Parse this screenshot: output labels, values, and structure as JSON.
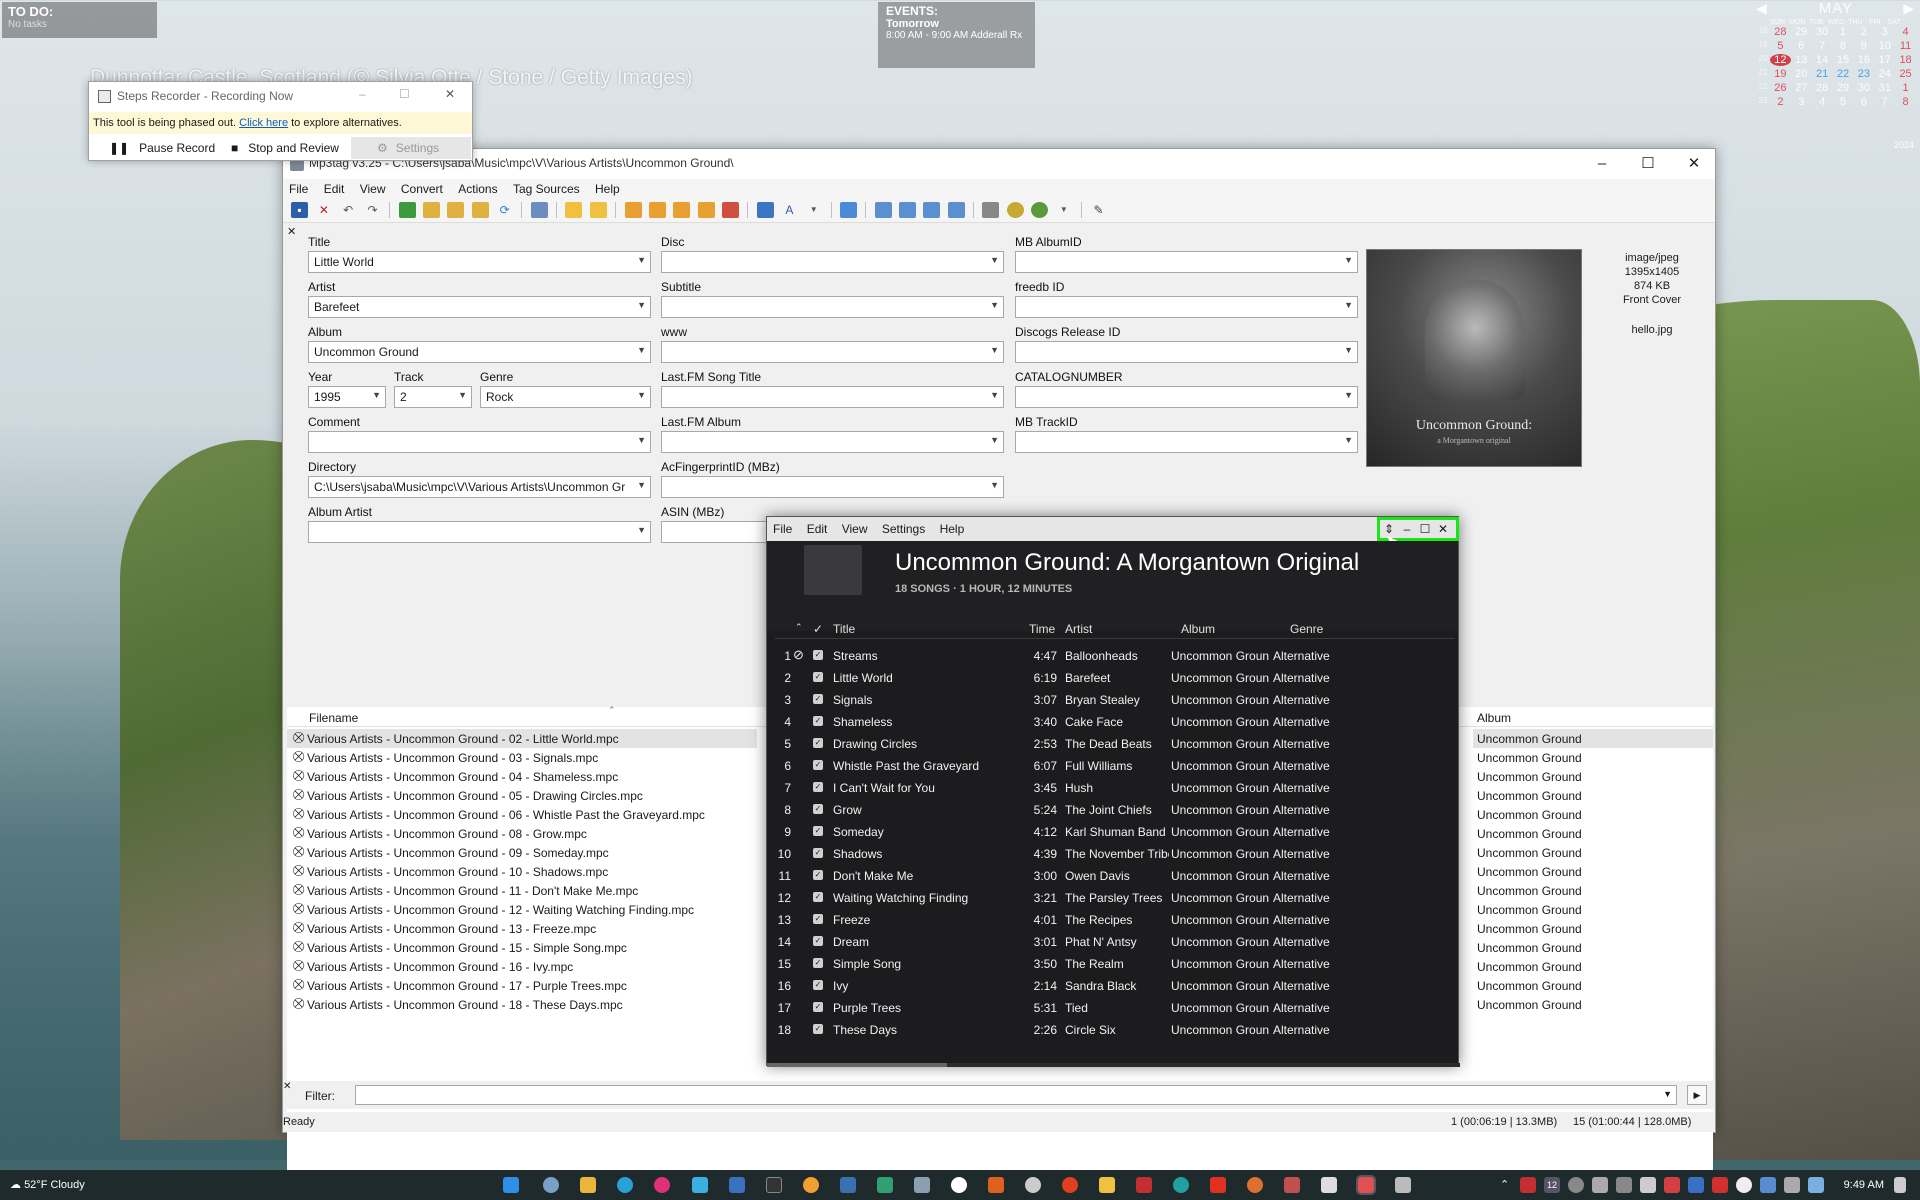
{
  "desktop": {
    "photo_credit": "Dunnottar Castle, Scotland (© Silvia Otte / Stone / Getty Images)",
    "todo": {
      "title": "TO DO:",
      "body": "No tasks"
    },
    "events": {
      "title": "EVENTS:",
      "day": "Tomorrow",
      "detail": "8:00 AM - 9:00 AM Adderall Rx"
    },
    "calendar": {
      "month": "MAY",
      "year": "2024",
      "dow": [
        "SUN",
        "MON",
        "TUE",
        "WED",
        "THU",
        "FRI",
        "SAT"
      ],
      "weeks": [
        {
          "wk": "18",
          "days": [
            "28",
            "29",
            "30",
            "1",
            "2",
            "3",
            "4"
          ]
        },
        {
          "wk": "19",
          "days": [
            "5",
            "6",
            "7",
            "8",
            "9",
            "10",
            "11"
          ]
        },
        {
          "wk": "20",
          "days": [
            "12",
            "13",
            "14",
            "15",
            "16",
            "17",
            "18"
          ]
        },
        {
          "wk": "21",
          "days": [
            "19",
            "20",
            "21",
            "22",
            "23",
            "24",
            "25"
          ]
        },
        {
          "wk": "22",
          "days": [
            "26",
            "27",
            "28",
            "29",
            "30",
            "31",
            "1"
          ]
        },
        {
          "wk": "23",
          "days": [
            "2",
            "3",
            "4",
            "5",
            "6",
            "7",
            "8"
          ]
        }
      ]
    }
  },
  "steps_recorder": {
    "title": "Steps Recorder - Recording Now",
    "warning_prefix": "This tool is being phased out.",
    "warning_link": "Click here",
    "warning_suffix": "to explore alternatives.",
    "pause_label": "Pause Record",
    "stop_label": "Stop and Review",
    "settings_label": "Settings"
  },
  "mp3tag": {
    "title": "Mp3tag v3.25 - C:\\Users\\jsaba\\Music\\mpc\\V\\Various Artists\\Uncommon Ground\\",
    "menu": [
      "File",
      "Edit",
      "View",
      "Convert",
      "Actions",
      "Tag Sources",
      "Help"
    ],
    "fields": {
      "title": {
        "label": "Title",
        "value": "Little World"
      },
      "artist": {
        "label": "Artist",
        "value": "Barefeet"
      },
      "album": {
        "label": "Album",
        "value": "Uncommon Ground"
      },
      "year": {
        "label": "Year",
        "value": "1995"
      },
      "track": {
        "label": "Track",
        "value": "2"
      },
      "genre": {
        "label": "Genre",
        "value": "Rock"
      },
      "comment": {
        "label": "Comment",
        "value": ""
      },
      "directory": {
        "label": "Directory",
        "value": "C:\\Users\\jsaba\\Music\\mpc\\V\\Various Artists\\Uncommon Gr"
      },
      "album_artist": {
        "label": "Album Artist",
        "value": ""
      },
      "disc": {
        "label": "Disc",
        "value": ""
      },
      "subtitle": {
        "label": "Subtitle",
        "value": ""
      },
      "www": {
        "label": "www",
        "value": ""
      },
      "lastfm_song_title": {
        "label": "Last.FM Song Title",
        "value": ""
      },
      "lastfm_album": {
        "label": "Last.FM Album",
        "value": ""
      },
      "acfingerprint": {
        "label": "AcFingerprintID (MBz)",
        "value": ""
      },
      "asin": {
        "label": "ASIN (MBz)",
        "value": ""
      },
      "mb_albumid": {
        "label": "MB AlbumID",
        "value": ""
      },
      "freedb_id": {
        "label": "freedb ID",
        "value": ""
      },
      "discogs_release_id": {
        "label": "Discogs Release ID",
        "value": ""
      },
      "catalognumber": {
        "label": "CATALOGNUMBER",
        "value": ""
      },
      "mb_trackid": {
        "label": "MB TrackID",
        "value": ""
      }
    },
    "cover": {
      "title": "Uncommon Ground:",
      "subtitle": "a Morgantown original",
      "mime": "image/jpeg",
      "dimensions": "1395x1405",
      "size": "874 KB",
      "type": "Front Cover",
      "filename": "hello.jpg"
    },
    "columns": {
      "filename": "Filename",
      "album": "Album"
    },
    "files": [
      {
        "name": "Various Artists  - Uncommon Ground  - 02  - Little World.mpc",
        "album": "Uncommon Ground"
      },
      {
        "name": "Various Artists  - Uncommon Ground  - 03  - Signals.mpc",
        "album": "Uncommon Ground"
      },
      {
        "name": "Various Artists  - Uncommon Ground  - 04  - Shameless.mpc",
        "album": "Uncommon Ground"
      },
      {
        "name": "Various Artists  - Uncommon Ground  - 05  - Drawing Circles.mpc",
        "album": "Uncommon Ground"
      },
      {
        "name": "Various Artists  - Uncommon Ground  - 06  - Whistle Past the Graveyard.mpc",
        "album": "Uncommon Ground"
      },
      {
        "name": "Various Artists  - Uncommon Ground  - 08  - Grow.mpc",
        "album": "Uncommon Ground"
      },
      {
        "name": "Various Artists  - Uncommon Ground  - 09  - Someday.mpc",
        "album": "Uncommon Ground"
      },
      {
        "name": "Various Artists  - Uncommon Ground  - 10  - Shadows.mpc",
        "album": "Uncommon Ground"
      },
      {
        "name": "Various Artists  - Uncommon Ground  - 11  - Don't Make Me.mpc",
        "album": "Uncommon Ground"
      },
      {
        "name": "Various Artists  - Uncommon Ground  - 12  - Waiting Watching Finding.mpc",
        "album": "Uncommon Ground"
      },
      {
        "name": "Various Artists  - Uncommon Ground  - 13  - Freeze.mpc",
        "album": "Uncommon Ground"
      },
      {
        "name": "Various Artists  - Uncommon Ground  - 15  - Simple Song.mpc",
        "album": "Uncommon Ground"
      },
      {
        "name": "Various Artists  - Uncommon Ground  - 16  - Ivy.mpc",
        "album": "Uncommon Ground"
      },
      {
        "name": "Various Artists  - Uncommon Ground  - 17  - Purple Trees.mpc",
        "album": "Uncommon Ground"
      },
      {
        "name": "Various Artists  - Uncommon Ground  - 18  - These Days.mpc",
        "album": "Uncommon Ground"
      }
    ],
    "filter_label": "Filter:",
    "status": {
      "ready": "Ready",
      "selection": "1 (00:06:19 | 13.3MB)",
      "total": "15 (01:00:44 | 128.0MB)"
    }
  },
  "player": {
    "menu": [
      "File",
      "Edit",
      "View",
      "Settings",
      "Help"
    ],
    "album_title": "Uncommon Ground: A Morgantown Original",
    "meta": "18 SONGS · 1 HOUR, 12 MINUTES",
    "columns": {
      "title": "Title",
      "time": "Time",
      "artist": "Artist",
      "album": "Album",
      "genre": "Genre"
    },
    "tracks": [
      {
        "n": "1",
        "title": "Streams",
        "time": "4:47",
        "artist": "Balloonheads",
        "album": "Uncommon Groun...",
        "genre": "Alternative"
      },
      {
        "n": "2",
        "title": "Little World",
        "time": "6:19",
        "artist": "Barefeet",
        "album": "Uncommon Groun...",
        "genre": "Alternative"
      },
      {
        "n": "3",
        "title": "Signals",
        "time": "3:07",
        "artist": "Bryan Stealey",
        "album": "Uncommon Groun...",
        "genre": "Alternative"
      },
      {
        "n": "4",
        "title": "Shameless",
        "time": "3:40",
        "artist": "Cake Face",
        "album": "Uncommon Groun...",
        "genre": "Alternative"
      },
      {
        "n": "5",
        "title": "Drawing Circles",
        "time": "2:53",
        "artist": "The Dead Beats",
        "album": "Uncommon Groun...",
        "genre": "Alternative"
      },
      {
        "n": "6",
        "title": "Whistle Past the Graveyard",
        "time": "6:07",
        "artist": "Full Williams",
        "album": "Uncommon Groun...",
        "genre": "Alternative"
      },
      {
        "n": "7",
        "title": "I Can't Wait for You",
        "time": "3:45",
        "artist": "Hush",
        "album": "Uncommon Groun...",
        "genre": "Alternative"
      },
      {
        "n": "8",
        "title": "Grow",
        "time": "5:24",
        "artist": "The Joint Chiefs",
        "album": "Uncommon Groun...",
        "genre": "Alternative"
      },
      {
        "n": "9",
        "title": "Someday",
        "time": "4:12",
        "artist": "Karl Shuman Band",
        "album": "Uncommon Groun...",
        "genre": "Alternative"
      },
      {
        "n": "10",
        "title": "Shadows",
        "time": "4:39",
        "artist": "The November Tribe",
        "album": "Uncommon Groun...",
        "genre": "Alternative"
      },
      {
        "n": "11",
        "title": "Don't Make Me",
        "time": "3:00",
        "artist": "Owen Davis",
        "album": "Uncommon Groun...",
        "genre": "Alternative"
      },
      {
        "n": "12",
        "title": "Waiting Watching Finding",
        "time": "3:21",
        "artist": "The Parsley Trees",
        "album": "Uncommon Groun...",
        "genre": "Alternative"
      },
      {
        "n": "13",
        "title": "Freeze",
        "time": "4:01",
        "artist": "The Recipes",
        "album": "Uncommon Groun...",
        "genre": "Alternative"
      },
      {
        "n": "14",
        "title": "Dream",
        "time": "3:01",
        "artist": "Phat N' Antsy",
        "album": "Uncommon Groun...",
        "genre": "Alternative"
      },
      {
        "n": "15",
        "title": "Simple Song",
        "time": "3:50",
        "artist": "The Realm",
        "album": "Uncommon Groun...",
        "genre": "Alternative"
      },
      {
        "n": "16",
        "title": "Ivy",
        "time": "2:14",
        "artist": "Sandra Black",
        "album": "Uncommon Groun...",
        "genre": "Alternative"
      },
      {
        "n": "17",
        "title": "Purple Trees",
        "time": "5:31",
        "artist": "Tied",
        "album": "Uncommon Groun...",
        "genre": "Alternative"
      },
      {
        "n": "18",
        "title": "These Days",
        "time": "2:26",
        "artist": "Circle Six",
        "album": "Uncommon Groun...",
        "genre": "Alternative"
      }
    ]
  },
  "taskbar": {
    "weather": "52°F Cloudy",
    "time": "9:49 AM",
    "tray_badge": "12"
  },
  "colors": {
    "highlight_green": "#19e619",
    "player_bg": "#1c1c1e",
    "mp3tag_bg": "#f0f0f0"
  }
}
